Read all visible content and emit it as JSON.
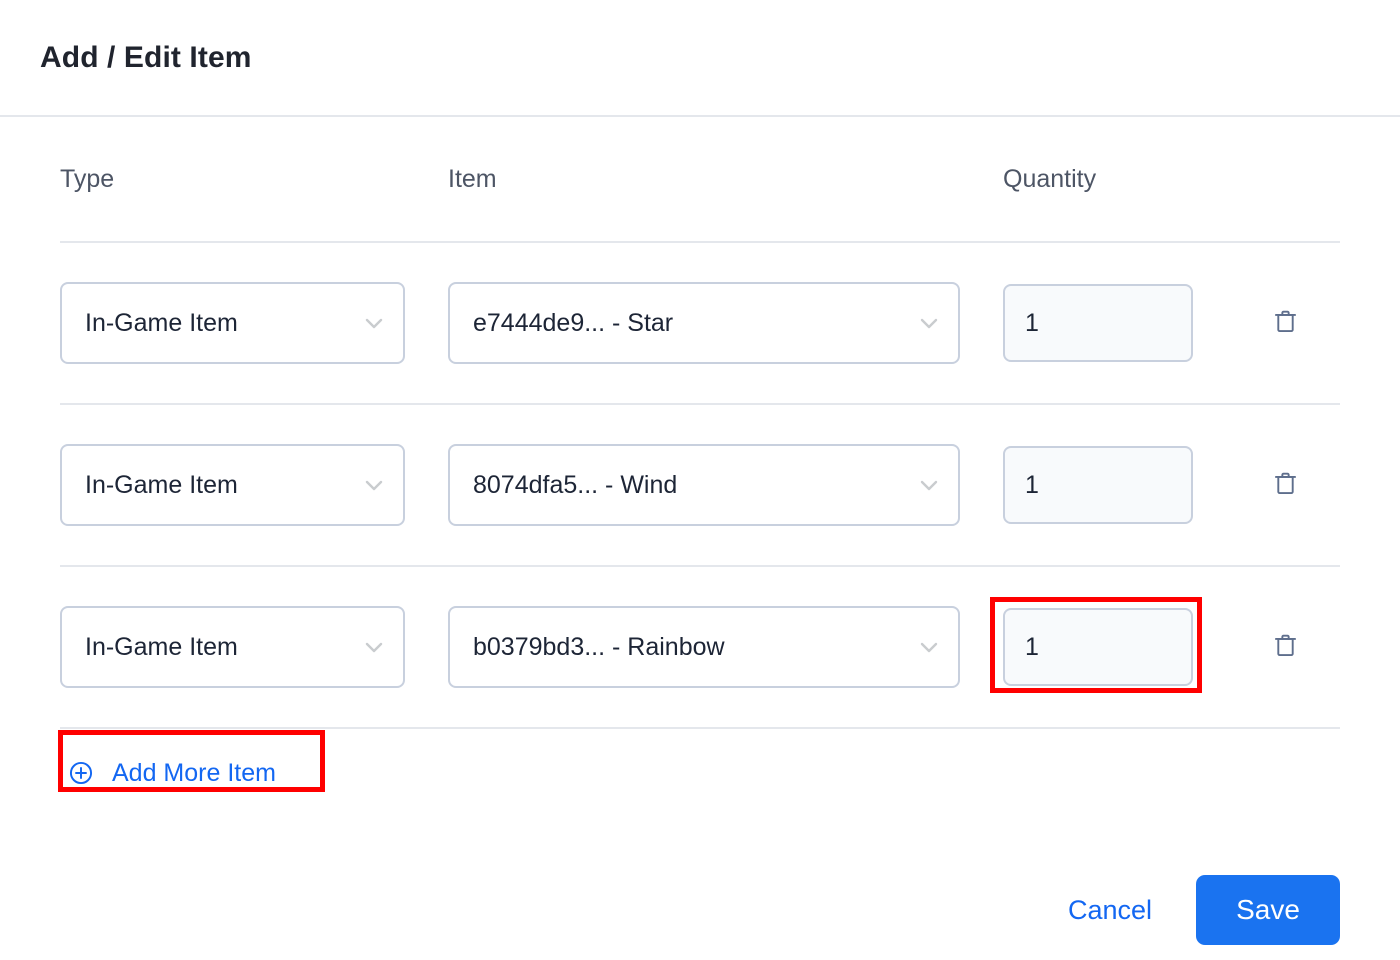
{
  "dialog": {
    "title": "Add / Edit Item",
    "accent_color": "#1a73f0",
    "link_color": "#1367f2",
    "highlight_color": "#ff0000"
  },
  "table": {
    "columns": [
      "Type",
      "Item",
      "Quantity"
    ],
    "rows": [
      {
        "type": "In-Game Item",
        "item": "e7444de9... - Star",
        "quantity": "1",
        "delete_icon": "trash-icon",
        "type_chevron": "chevron-down-icon",
        "item_chevron": "chevron-down-icon"
      },
      {
        "type": "In-Game Item",
        "item": "8074dfa5... - Wind",
        "quantity": "1",
        "delete_icon": "trash-icon",
        "type_chevron": "chevron-down-icon",
        "item_chevron": "chevron-down-icon"
      },
      {
        "type": "In-Game Item",
        "item": "b0379bd3... - Rainbow",
        "quantity": "1",
        "delete_icon": "trash-icon",
        "type_chevron": "chevron-down-icon",
        "item_chevron": "chevron-down-icon"
      }
    ]
  },
  "add_more": {
    "label": "Add More Item",
    "icon": "plus-circle-icon"
  },
  "footer": {
    "cancel_label": "Cancel",
    "save_label": "Save"
  }
}
